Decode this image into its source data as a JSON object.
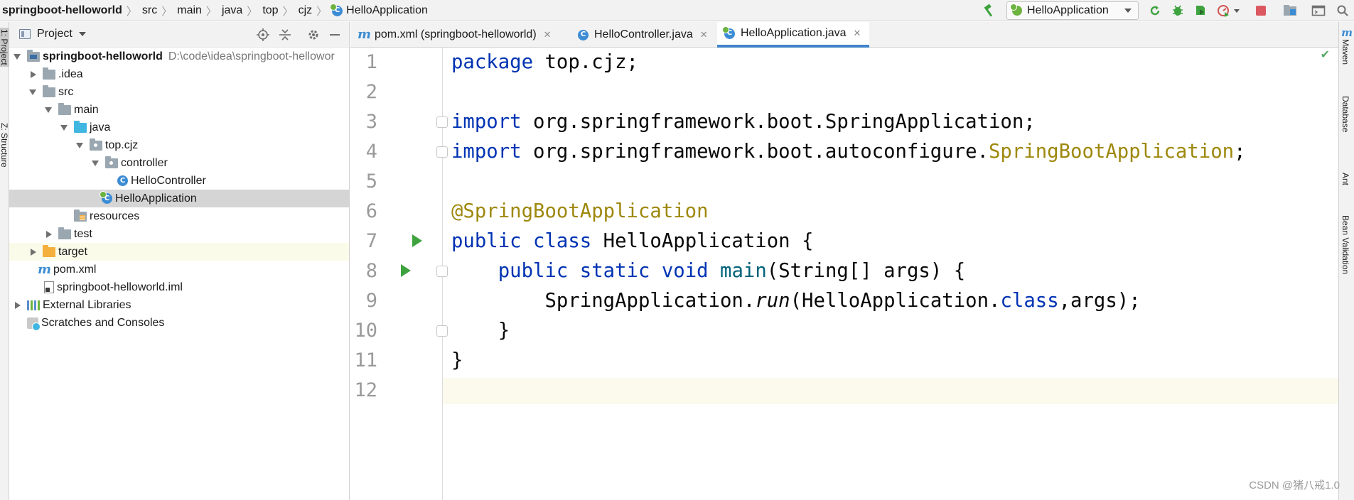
{
  "breadcrumbs": [
    "springboot-helloworld",
    "src",
    "main",
    "java",
    "top",
    "cjz",
    "HelloApplication"
  ],
  "run_config": {
    "label": "HelloApplication"
  },
  "left_stripe": {
    "project": "1: Project",
    "structure": "Z: Structure"
  },
  "project_panel": {
    "title": "Project",
    "tree": [
      {
        "label": "springboot-helloworld",
        "path": "D:\\code\\idea\\springboot-hellowor",
        "icon": "module-folder-icon",
        "toggle": "open"
      },
      {
        "label": ".idea",
        "icon": "folder-icon",
        "toggle": "closed"
      },
      {
        "label": "src",
        "icon": "folder-icon",
        "toggle": "open"
      },
      {
        "label": "main",
        "icon": "folder-icon",
        "toggle": "open"
      },
      {
        "label": "java",
        "icon": "source-folder-icon",
        "toggle": "open"
      },
      {
        "label": "top.cjz",
        "icon": "package-icon",
        "toggle": "open"
      },
      {
        "label": "controller",
        "icon": "package-icon",
        "toggle": "open"
      },
      {
        "label": "HelloController",
        "icon": "class-icon",
        "toggle": "none"
      },
      {
        "label": "HelloApplication",
        "icon": "spring-boot-class-icon",
        "toggle": "none"
      },
      {
        "label": "resources",
        "icon": "resources-folder-icon",
        "toggle": "none"
      },
      {
        "label": "test",
        "icon": "folder-icon",
        "toggle": "closed"
      },
      {
        "label": "target",
        "icon": "excluded-folder-icon",
        "toggle": "closed"
      },
      {
        "label": "pom.xml",
        "icon": "maven-icon",
        "toggle": "none"
      },
      {
        "label": "springboot-helloworld.iml",
        "icon": "iml-file-icon",
        "toggle": "none"
      },
      {
        "label": "External Libraries",
        "icon": "library-icon",
        "toggle": "closed"
      },
      {
        "label": "Scratches and Consoles",
        "icon": "scratches-icon",
        "toggle": "none"
      }
    ]
  },
  "editor_tabs": [
    {
      "label": "pom.xml (springboot-helloworld)"
    },
    {
      "label": "HelloController.java"
    },
    {
      "label": "HelloApplication.java"
    }
  ],
  "line_numbers": [
    "1",
    "2",
    "3",
    "4",
    "5",
    "6",
    "7",
    "8",
    "9",
    "10",
    "11",
    "12"
  ],
  "code": {
    "l1_kw": "package",
    "l1_rest": " top.cjz;",
    "l3_kw": "import",
    "l3_rest": " org.springframework.boot.SpringApplication;",
    "l4_kw": "import",
    "l4_a": " org.springframework.boot.autoconfigure.",
    "l4_b": "SpringBootApplication",
    "l4_c": ";",
    "l6_ann": "@SpringBootApplication",
    "l7_kw1": "public",
    "l7_sp": " ",
    "l7_kw2": "class",
    "l7_rest": " HelloApplication {",
    "l8_indent": "    ",
    "l8_kw1": "public",
    "l8_kw2": "static",
    "l8_kw3": "void",
    "l8_fn": "main",
    "l8_rest": "(String[] args) {",
    "l9_indent": "        ",
    "l9_a": "SpringApplication.",
    "l9_it": "run",
    "l9_b": "(HelloApplication.",
    "l9_kw": "class",
    "l9_c": ",args);",
    "l10": "    }",
    "l11": "}"
  },
  "right_stripe": [
    "Maven",
    "Database",
    "Ant",
    "Bean Validation"
  ],
  "watermark": "CSDN @猪八戒1.0",
  "colors": {
    "keyword": "#0033b3",
    "annotation": "#9e880d",
    "accent": "#4083c9",
    "run_green": "#3ea33e"
  }
}
